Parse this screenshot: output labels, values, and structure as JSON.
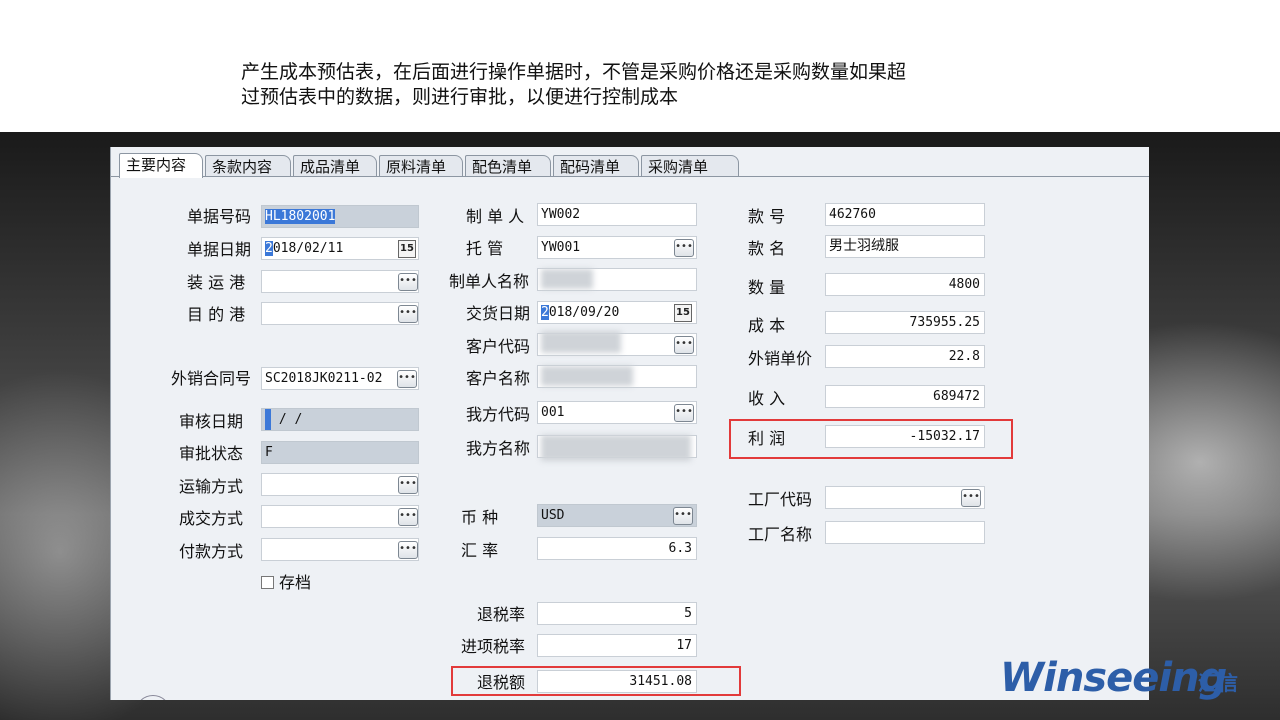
{
  "caption": {
    "line1": "产生成本预估表，在后面进行操作单据时，不管是采购价格还是采购数量如果超",
    "line2": "过预估表中的数据，则进行审批，以便进行控制成本"
  },
  "tabs": [
    "主要内容",
    "条款内容",
    "成品清单",
    "原料清单",
    "配色清单",
    "配码清单",
    "采购清单"
  ],
  "col1": {
    "doc_no_label": "单据号码",
    "doc_no_value": "HL1802001",
    "doc_date_label": "单据日期",
    "doc_date_first": "2",
    "doc_date_rest": "018/02/11",
    "load_port_label": "装 运 港",
    "load_port_value": "",
    "dest_port_label": "目 的 港",
    "dest_port_value": "",
    "contract_label": "外销合同号",
    "contract_value": "SC2018JK0211-02",
    "audit_date_label": "审核日期",
    "audit_date_value": " /  /",
    "approve_status_label": "审批状态",
    "approve_status_value": "F",
    "transport_label": "运输方式",
    "transport_value": "",
    "deal_label": "成交方式",
    "deal_value": "",
    "payment_label": "付款方式",
    "payment_value": "",
    "archive_label": "存档"
  },
  "col2": {
    "maker_label": "制 单 人",
    "maker_value": "YW002",
    "custody_label": "托    管",
    "custody_value": "YW001",
    "maker_name_label": "制单人名称",
    "delivery_label": "交货日期",
    "delivery_first": "2",
    "delivery_rest": "018/09/20",
    "customer_code_label": "客户代码",
    "customer_name_label": "客户名称",
    "our_code_label": "我方代码",
    "our_code_value": "001",
    "our_name_label": "我方名称",
    "currency_label": "币    种",
    "currency_value": "USD",
    "rate_label": "汇    率",
    "rate_value": "6.3",
    "rebate_rate_label": "退税率",
    "rebate_rate_value": "5",
    "input_tax_label": "进项税率",
    "input_tax_value": "17",
    "rebate_amount_label": "退税额",
    "rebate_amount_value": "31451.08"
  },
  "col3": {
    "style_no_label": "款    号",
    "style_no_value": "462760",
    "style_name_label": "款    名",
    "style_name_value": "男士羽绒服",
    "qty_label": "数    量",
    "qty_value": "4800",
    "cost_label": "成    本",
    "cost_value": "735955.25",
    "unit_price_label": "外销单价",
    "unit_price_value": "22.8",
    "income_label": "收    入",
    "income_value": "689472",
    "profit_label": "利    润",
    "profit_value": "-15032.17",
    "factory_code_label": "工厂代码",
    "factory_code_value": "",
    "factory_name_label": "工厂名称",
    "factory_name_value": ""
  },
  "icons": {
    "lookup": "ellipsis-icon",
    "calendar": "calendar-icon",
    "calendar_text": "15",
    "lookup_text": "•••"
  },
  "logo": {
    "text": "Winseeing",
    "cn": "汇信"
  },
  "colors": {
    "highlight_box": "#e23a3a",
    "readonly_bg": "#c9d1da",
    "selection": "#3b78d8"
  }
}
